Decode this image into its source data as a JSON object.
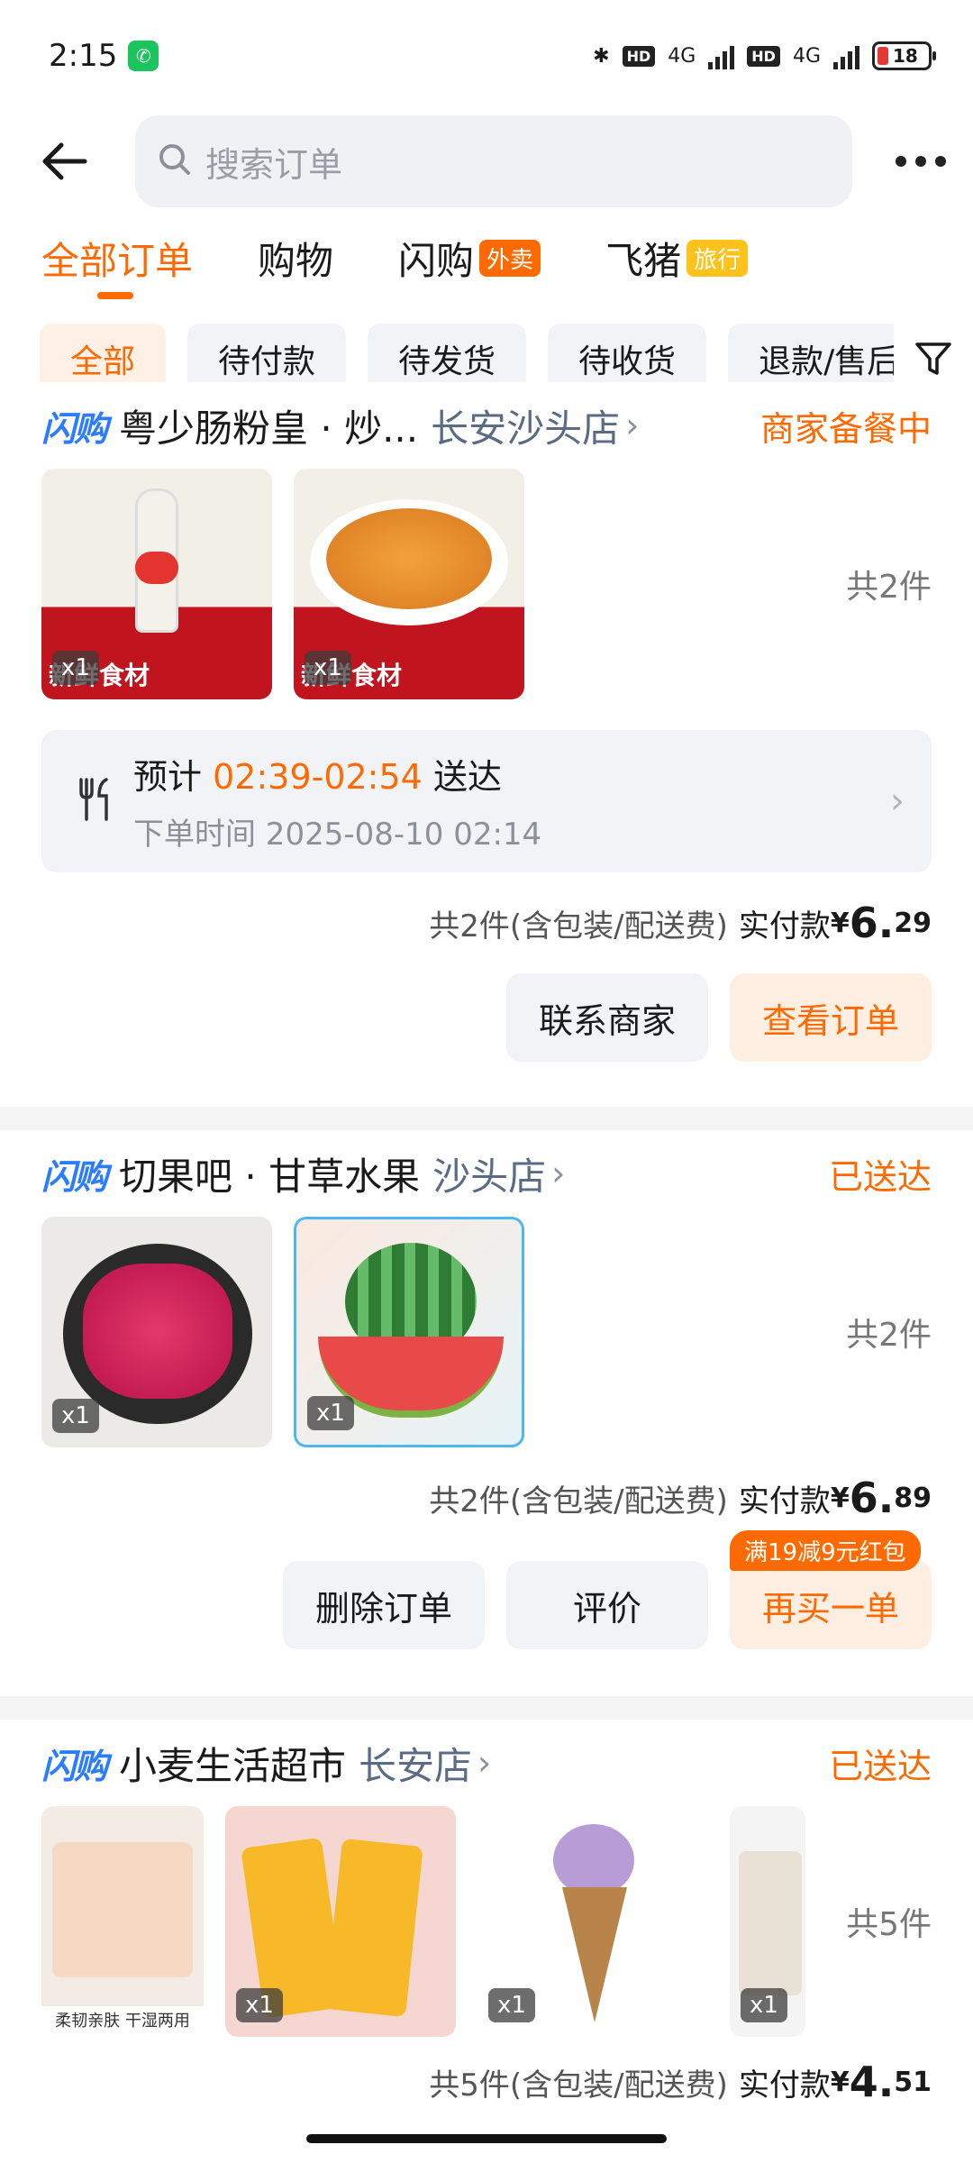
{
  "status_bar": {
    "time": "2:15",
    "battery": "18",
    "net1": "4G",
    "net2": "4G",
    "hd": "HD"
  },
  "search": {
    "placeholder": "搜索订单"
  },
  "tabs": [
    {
      "label": "全部订单",
      "tag": ""
    },
    {
      "label": "购物",
      "tag": ""
    },
    {
      "label": "闪购",
      "tag": "外卖"
    },
    {
      "label": "飞猪",
      "tag": "旅行"
    }
  ],
  "filters": [
    "全部",
    "待付款",
    "待发货",
    "待收货",
    "退款/售后"
  ],
  "brand": {
    "logo": "闪购"
  },
  "orders": [
    {
      "shop": "粤少肠粉皇 · 炒...",
      "branch": "长安沙头店",
      "status": "商家备餐中",
      "item_count": "共2件",
      "items": [
        {
          "qty": "x1",
          "caption": "新鲜食材"
        },
        {
          "qty": "x1",
          "caption": "新鲜食材"
        }
      ],
      "eta_prefix": "预计",
      "eta_time": "02:39-02:54",
      "eta_suffix": "送达",
      "order_time": "下单时间 2025-08-10 02:14",
      "summary": "共2件(含包装/配送费)",
      "pay_label": "实付款",
      "currency": "¥",
      "price_int": "6.",
      "price_dec": "29",
      "buttons": [
        "联系商家",
        "查看订单"
      ]
    },
    {
      "shop": "切果吧 · 甘草水果",
      "branch": "沙头店",
      "status": "已送达",
      "item_count": "共2件",
      "items": [
        {
          "qty": "x1"
        },
        {
          "qty": "x1"
        }
      ],
      "summary": "共2件(含包装/配送费)",
      "pay_label": "实付款",
      "currency": "¥",
      "price_int": "6.",
      "price_dec": "89",
      "buttons": [
        "删除订单",
        "评价",
        "再买一单"
      ],
      "promo": "满19减9元红包"
    },
    {
      "shop": "小麦生活超市",
      "branch": "长安店",
      "status": "已送达",
      "item_count": "共5件",
      "items": [
        {
          "qty": "",
          "caption": "柔韧亲肤 干湿两用"
        },
        {
          "qty": "x1"
        },
        {
          "qty": "x1"
        },
        {
          "qty": "x1"
        }
      ],
      "summary": "共5件(含包装/配送费)",
      "pay_label": "实付款",
      "currency": "¥",
      "price_int": "4.",
      "price_dec": "51"
    }
  ]
}
